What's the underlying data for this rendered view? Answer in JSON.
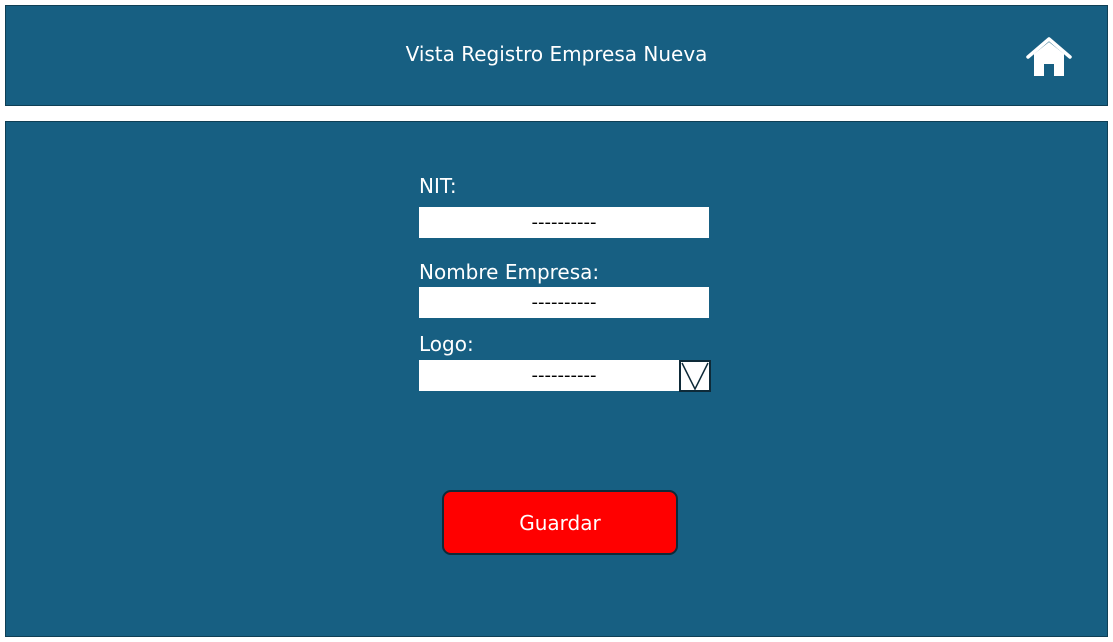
{
  "header": {
    "title": "Vista Registro Empresa Nueva",
    "home_icon": "home-icon"
  },
  "form": {
    "nit": {
      "label": "NIT:",
      "value": "----------"
    },
    "nombre_empresa": {
      "label": "Nombre Empresa:",
      "value": "----------"
    },
    "logo": {
      "label": "Logo:",
      "value": "----------",
      "toggle_icon": "chevron-down-icon"
    },
    "save_label": "Guardar"
  },
  "colors": {
    "background": "#175f82",
    "save_button": "#ff0000",
    "text": "#ffffff"
  }
}
